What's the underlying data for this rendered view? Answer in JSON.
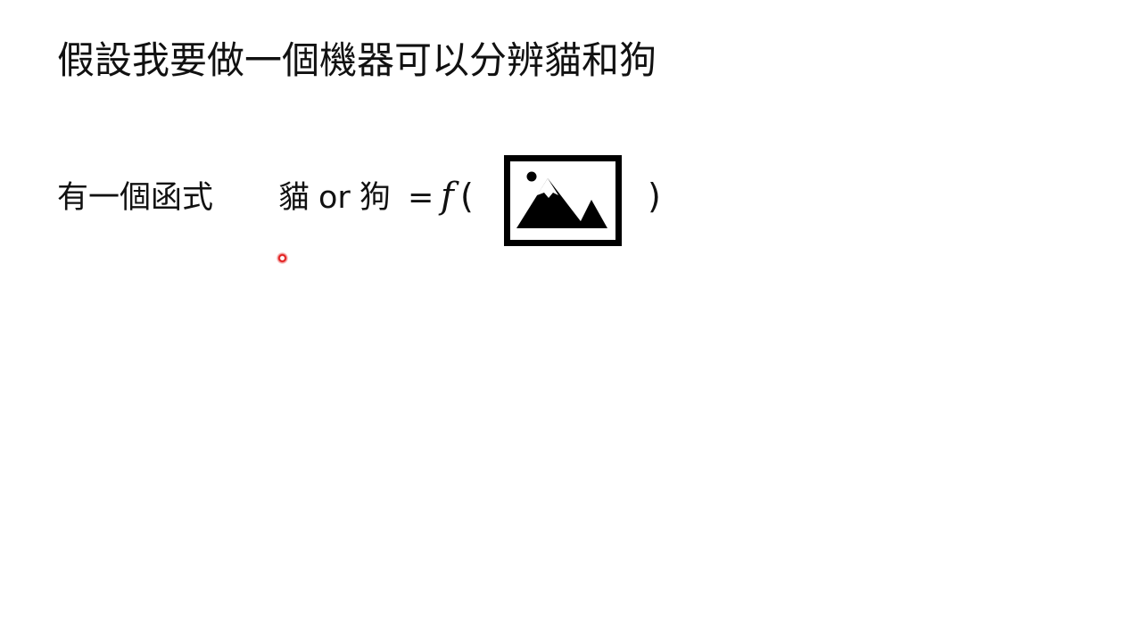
{
  "slide": {
    "title": "假設我要做一個機器可以分辨貓和狗",
    "function_label": "有一個函式",
    "output_cat": "貓",
    "output_or": "or",
    "output_dog": "狗",
    "equals": "=",
    "function_symbol": "f",
    "paren_open": "(",
    "paren_close": ")",
    "image_icon": "image-placeholder-icon",
    "pointer_color": "#e21a1a"
  }
}
